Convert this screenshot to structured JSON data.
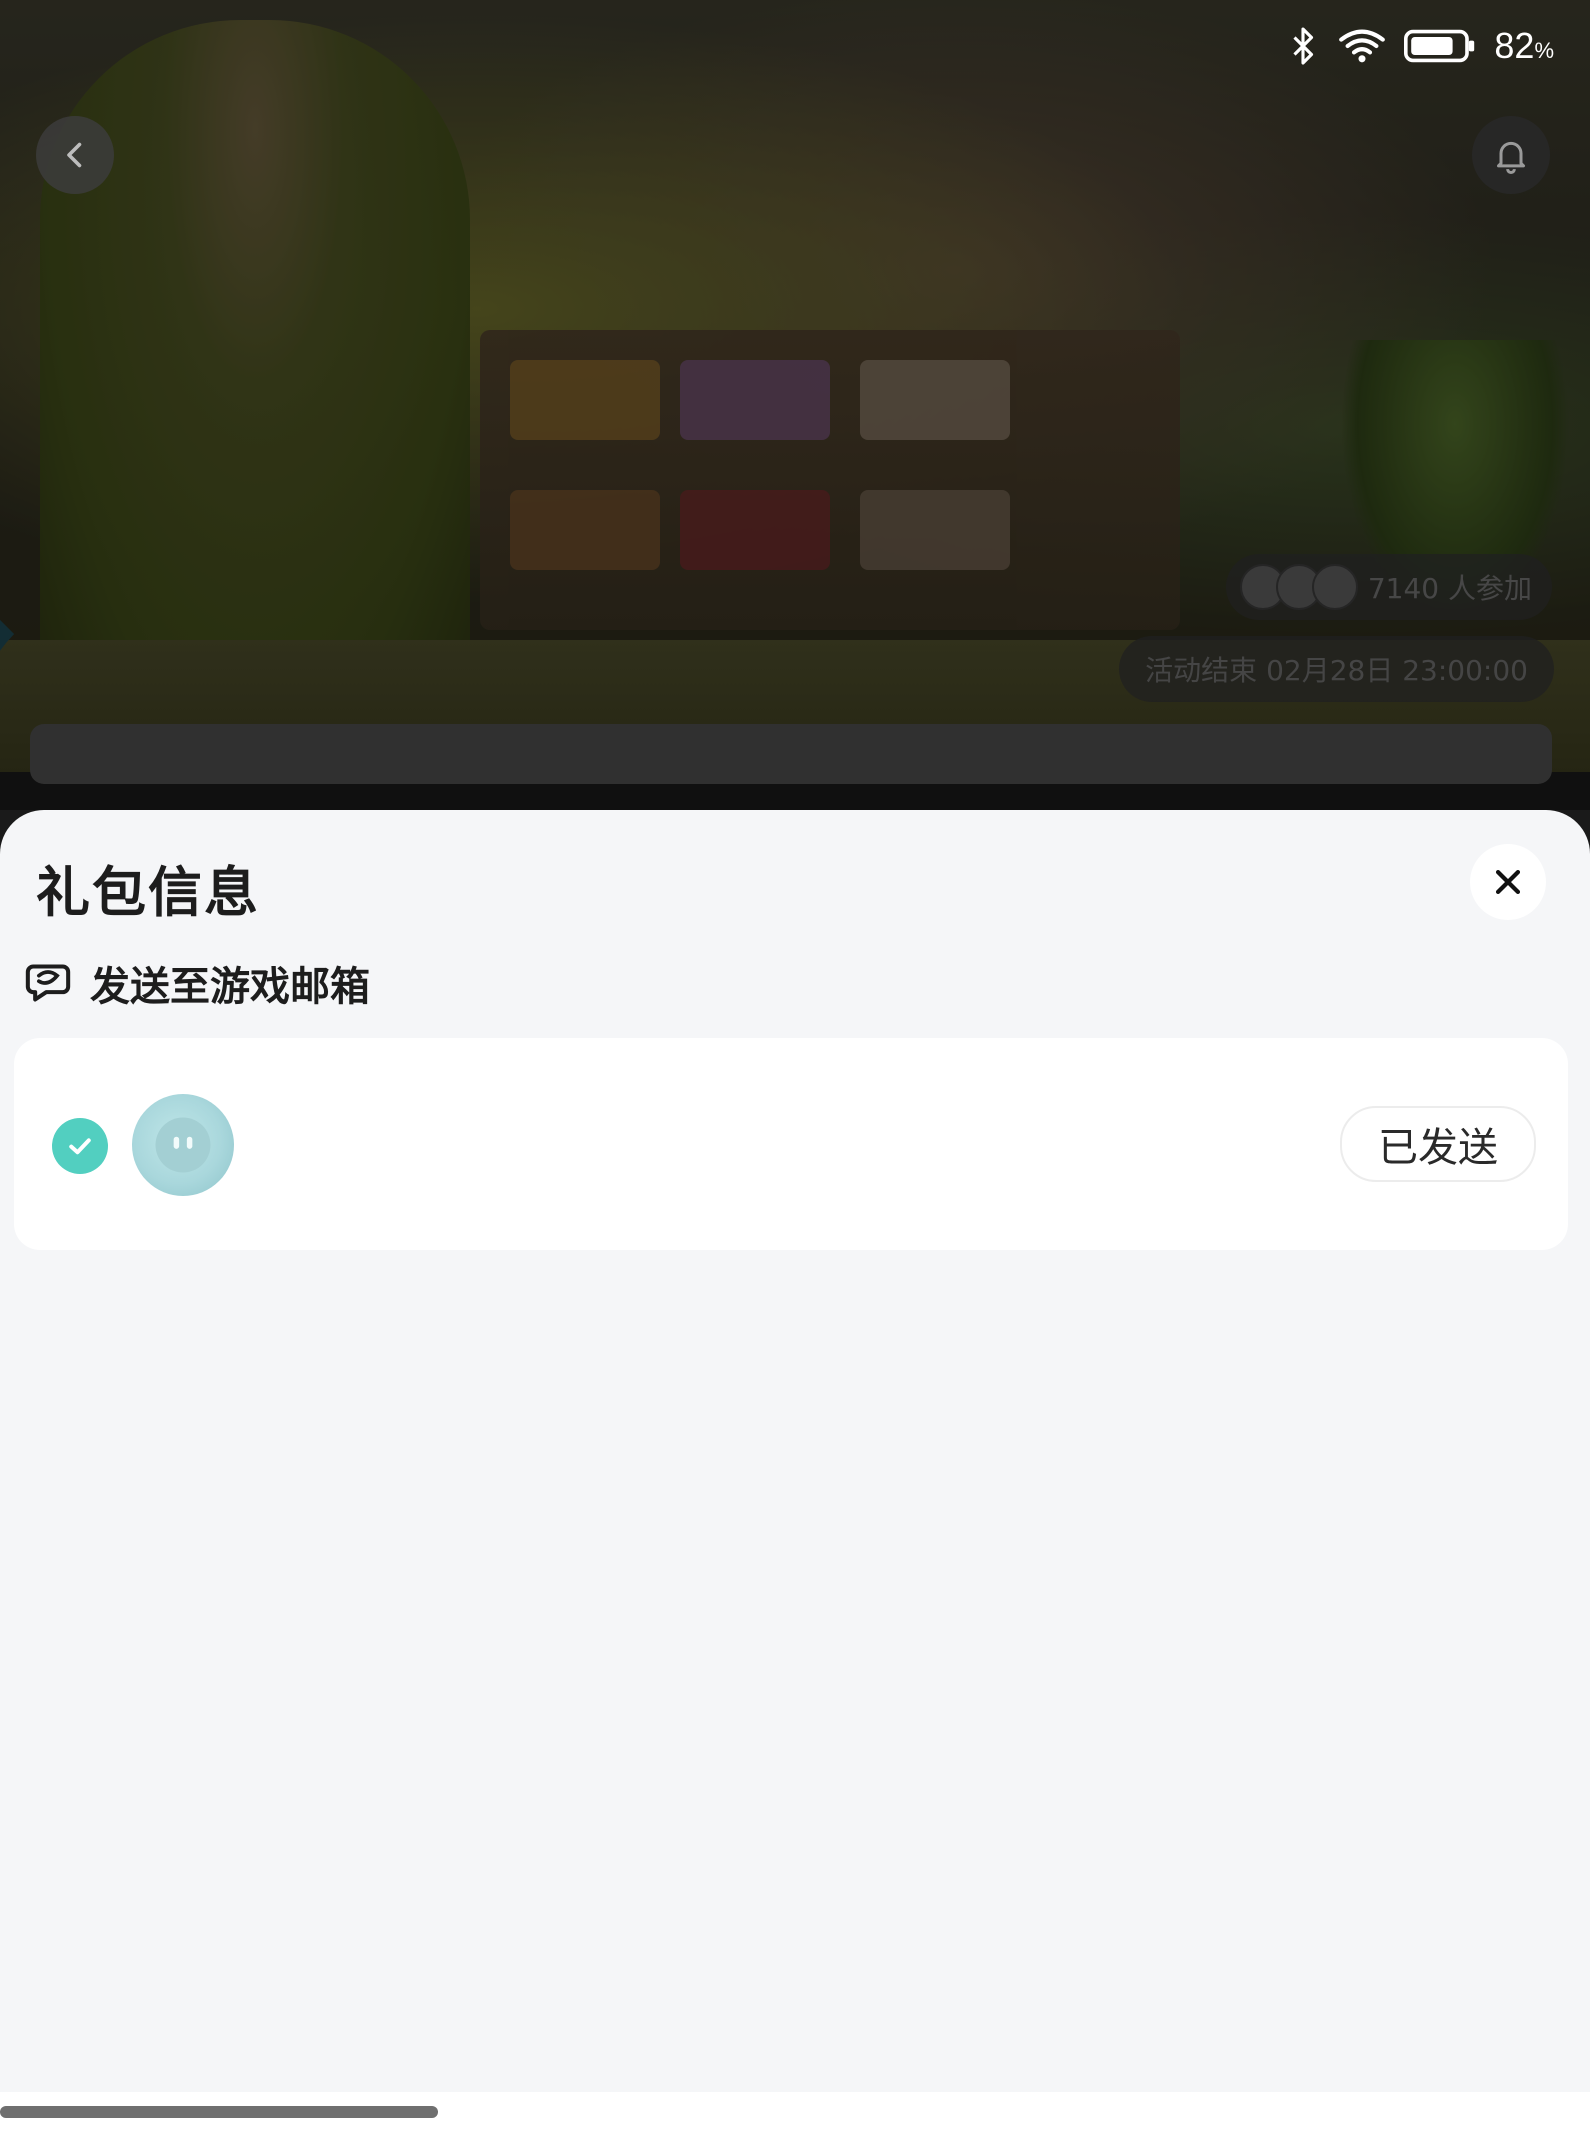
{
  "status_bar": {
    "battery_percent": "82",
    "percent_sign": "%",
    "icons": [
      "bluetooth-icon",
      "wifi-icon",
      "battery-icon"
    ]
  },
  "banner": {
    "participants_text": "7140 人参加",
    "end_time_text": "活动结束 02月28日 23:00:00"
  },
  "sheet": {
    "title": "礼包信息",
    "section_label": "发送至游戏邮箱",
    "card": {
      "sent_button_label": "已发送"
    }
  },
  "colors": {
    "accent_check": "#52cfc0",
    "sheet_bg": "#f5f6f8"
  }
}
